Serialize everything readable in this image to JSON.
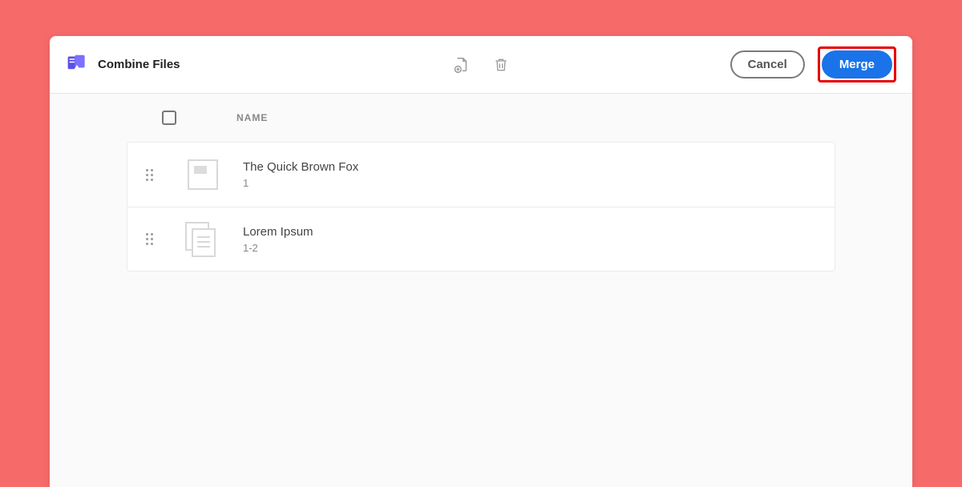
{
  "header": {
    "title": "Combine Files",
    "cancel_label": "Cancel",
    "merge_label": "Merge"
  },
  "columns": {
    "name": "NAME"
  },
  "files": [
    {
      "name": "The Quick Brown Fox",
      "pages": "1"
    },
    {
      "name": "Lorem Ipsum",
      "pages": "1-2"
    }
  ]
}
